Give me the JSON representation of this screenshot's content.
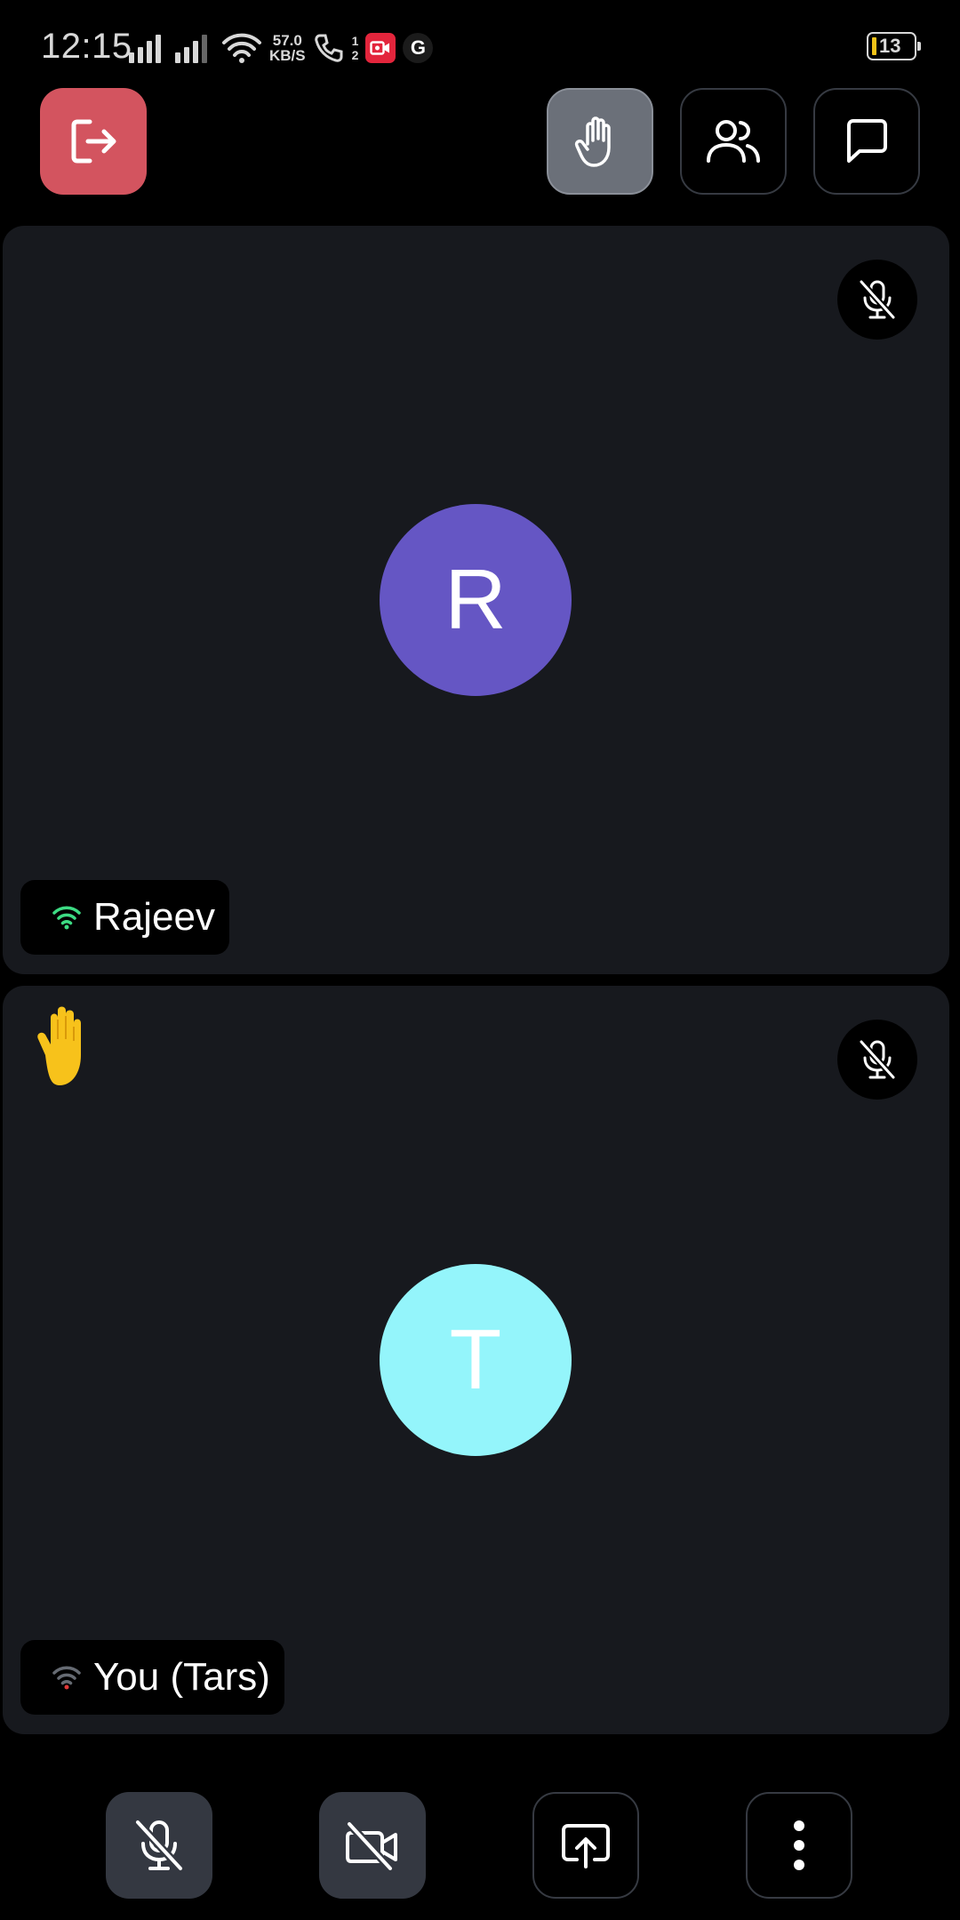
{
  "status_bar": {
    "time": "12:15",
    "net_speed_value": "57.0",
    "net_speed_unit": "KB/S",
    "sim_slot_1": "1",
    "sim_slot_2": "2",
    "google_badge": "G",
    "battery_level": "13"
  },
  "toolbar": {
    "leave_icon": "leave-icon",
    "raise_hand_icon": "hand-icon",
    "participants_icon": "people-icon",
    "chat_icon": "chat-icon"
  },
  "participants": [
    {
      "name": "Rajeev",
      "initial": "R",
      "avatar_color": "#6556c4",
      "signal_color": "#3ddc84",
      "muted": true,
      "hand_raised": false
    },
    {
      "name": "You (Tars)",
      "initial": "T",
      "avatar_color": "#94f5fb",
      "signal_color": "#666b73",
      "muted": true,
      "hand_raised": true
    }
  ],
  "controls": {
    "mic": "mic-off-icon",
    "camera": "camera-off-icon",
    "share_screen": "share-screen-icon",
    "more": "more-vertical-icon"
  },
  "colors": {
    "leave_button": "#d3545f",
    "raise_hand_active": "#6b7079",
    "tile_background": "#17191e",
    "raised_hand_emoji": "#f7c21b"
  }
}
